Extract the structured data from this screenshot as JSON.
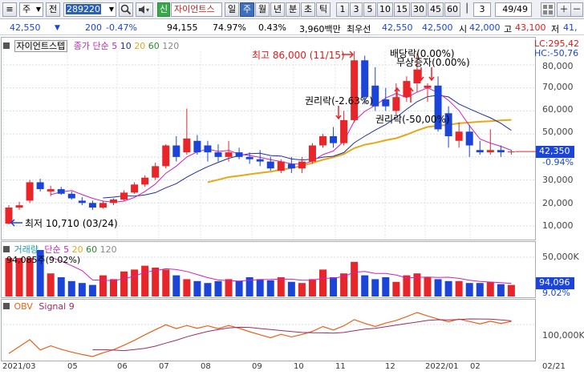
{
  "toolbar": {
    "chart_menu": "≡",
    "period_select": "주",
    "prev_label": "전",
    "code": "289220",
    "search_icon": "search-icon",
    "sound_icon": "speaker-icon",
    "new_badge": "신",
    "stock_name": "자이언트스",
    "periods": [
      "일",
      "주",
      "월",
      "년",
      "분",
      "초",
      "틱"
    ],
    "active_period": "주",
    "minute_buttons": [
      "1",
      "3",
      "5",
      "10",
      "15",
      "30",
      "45",
      "60"
    ],
    "custom_input": "3",
    "page_counter": "49/49"
  },
  "infobar": {
    "price": "42,550",
    "change": "200",
    "change_pct": "-0.47%",
    "volume": "94,155",
    "turnover_pct": "74.97%",
    "rate": "0.43%",
    "amount": "3,960백만",
    "best_ask_label": "최우선",
    "best_ask": "42,550",
    "best_bid": "42,500",
    "open_label": "시",
    "open": "42,000",
    "high_label": "고",
    "high": "43,100",
    "low_label": "저",
    "low": "41,"
  },
  "price_panel": {
    "tab_label": "자이언트스텝",
    "legend_label": "종가 단순",
    "ma": [
      "5",
      "10",
      "20",
      "60",
      "120"
    ],
    "lc": "LC:295,42",
    "hc": "HC:-50,76",
    "current_price": "42,350",
    "current_pct": "-0.94%",
    "y_ticks": [
      "80,000",
      "70,000",
      "60,000",
      "50,000",
      "30,000",
      "20,000",
      "10,000"
    ],
    "annotations": {
      "high": "최고 86,000 (11/15)",
      "low": "최저 10,710 (03/24)",
      "rights1": "권리락(-2.63%)",
      "rights2": "권리락(-50,00%)",
      "dividend": "배당락(0.00%)",
      "bonus": "무상증자(0.00%)"
    }
  },
  "volume_panel": {
    "label": "거래량",
    "legend_label": "단순",
    "ma": [
      "5",
      "20",
      "60",
      "120"
    ],
    "annotation": "94,085주(9.02%)",
    "y_tick": "50,000K",
    "current": "94,096",
    "current_pct": "9.02%"
  },
  "obv_panel": {
    "label": "OBV",
    "signal_label": "Signal 9",
    "y_tick": "100,000K"
  },
  "x_axis": [
    "2021/03",
    "05",
    "06",
    "07",
    "08",
    "09",
    "10",
    "11",
    "12",
    "2022/01",
    "02",
    "02/21"
  ],
  "colors": {
    "up": "#e8262a",
    "down": "#1a45d8",
    "ma5": "#d020c0",
    "ma10": "#1f2fa0",
    "ma20": "#e6a817",
    "obv": "#e8621a",
    "signal": "#a02b5f"
  },
  "chart_data": {
    "type": "candlestick",
    "candles": [
      [
        11000,
        19000,
        10710,
        18000
      ],
      [
        18000,
        20500,
        17000,
        19000
      ],
      [
        21000,
        30000,
        20000,
        29000
      ],
      [
        29000,
        30500,
        25000,
        26000
      ],
      [
        25000,
        27500,
        23000,
        26000
      ],
      [
        26000,
        27000,
        23500,
        24000
      ],
      [
        24000,
        25000,
        21500,
        22000
      ],
      [
        21000,
        22500,
        19000,
        20000
      ],
      [
        20000,
        21000,
        17000,
        18000
      ],
      [
        18000,
        21000,
        17500,
        20000
      ],
      [
        20000,
        22000,
        19000,
        21500
      ],
      [
        21500,
        25500,
        21000,
        24500
      ],
      [
        24500,
        29000,
        24000,
        28000
      ],
      [
        28000,
        32000,
        27000,
        31000
      ],
      [
        31000,
        37500,
        30000,
        36000
      ],
      [
        36000,
        45500,
        35000,
        45000
      ],
      [
        45000,
        49000,
        38000,
        40000
      ],
      [
        42000,
        61000,
        41000,
        48000
      ],
      [
        47000,
        49500,
        41000,
        42000
      ],
      [
        45000,
        47000,
        38000,
        42000
      ],
      [
        42000,
        45500,
        38000,
        40000
      ],
      [
        40000,
        47000,
        38000,
        42000
      ],
      [
        42000,
        44000,
        39000,
        40000
      ],
      [
        40000,
        42000,
        37000,
        39000
      ],
      [
        39000,
        43000,
        36000,
        38000
      ],
      [
        38000,
        40000,
        34000,
        35000
      ],
      [
        34000,
        39000,
        33000,
        38000
      ],
      [
        37000,
        40000,
        33000,
        35000
      ],
      [
        35000,
        40000,
        33000,
        38000
      ],
      [
        38000,
        46000,
        37000,
        45000
      ],
      [
        45000,
        50000,
        44000,
        49000
      ],
      [
        49000,
        53000,
        44000,
        46000
      ],
      [
        46000,
        60000,
        45000,
        56000
      ],
      [
        56000,
        86000,
        55000,
        82000
      ],
      [
        82000,
        84000,
        63000,
        66000
      ],
      [
        71000,
        79000,
        60000,
        62000
      ],
      [
        65000,
        70000,
        60000,
        62000
      ],
      [
        60000,
        72000,
        58000,
        66000
      ],
      [
        66000,
        75000,
        64000,
        73000
      ],
      [
        72000,
        85000,
        68000,
        78000
      ],
      [
        70000,
        72000,
        64000,
        71000
      ],
      [
        71000,
        75000,
        51000,
        52000
      ],
      [
        59000,
        62000,
        44000,
        49000
      ],
      [
        47000,
        55000,
        44000,
        51000
      ],
      [
        51000,
        54000,
        40000,
        45000
      ],
      [
        43000,
        47000,
        41000,
        42000
      ],
      [
        42000,
        52000,
        41000,
        43000
      ],
      [
        43000,
        45000,
        40000,
        42000
      ],
      [
        42000,
        43100,
        41000,
        42350
      ]
    ],
    "volumes": [
      100,
      100,
      100,
      150,
      60,
      50,
      40,
      35,
      30,
      55,
      45,
      65,
      70,
      80,
      75,
      70,
      55,
      45,
      40,
      35,
      40,
      45,
      40,
      50,
      45,
      42,
      50,
      38,
      35,
      45,
      70,
      50,
      60,
      90,
      55,
      45,
      50,
      38,
      55,
      60,
      50,
      45,
      40,
      40,
      35,
      35,
      38,
      32,
      30
    ]
  }
}
